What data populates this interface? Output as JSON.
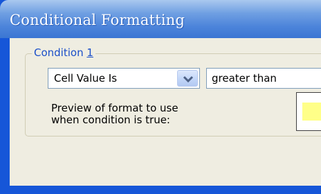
{
  "window": {
    "title": "Conditional Formatting"
  },
  "condition_group": {
    "label_prefix": "Condition ",
    "label_number": "1",
    "field1": {
      "selected": "Cell Value Is"
    },
    "field2": {
      "selected": "greater than"
    },
    "preview_label_line1": "Preview of format to use",
    "preview_label_line2": "when condition is true:",
    "preview_fill_color": "#ffff88"
  },
  "icons": {
    "dropdown": "chevron-down-icon"
  }
}
